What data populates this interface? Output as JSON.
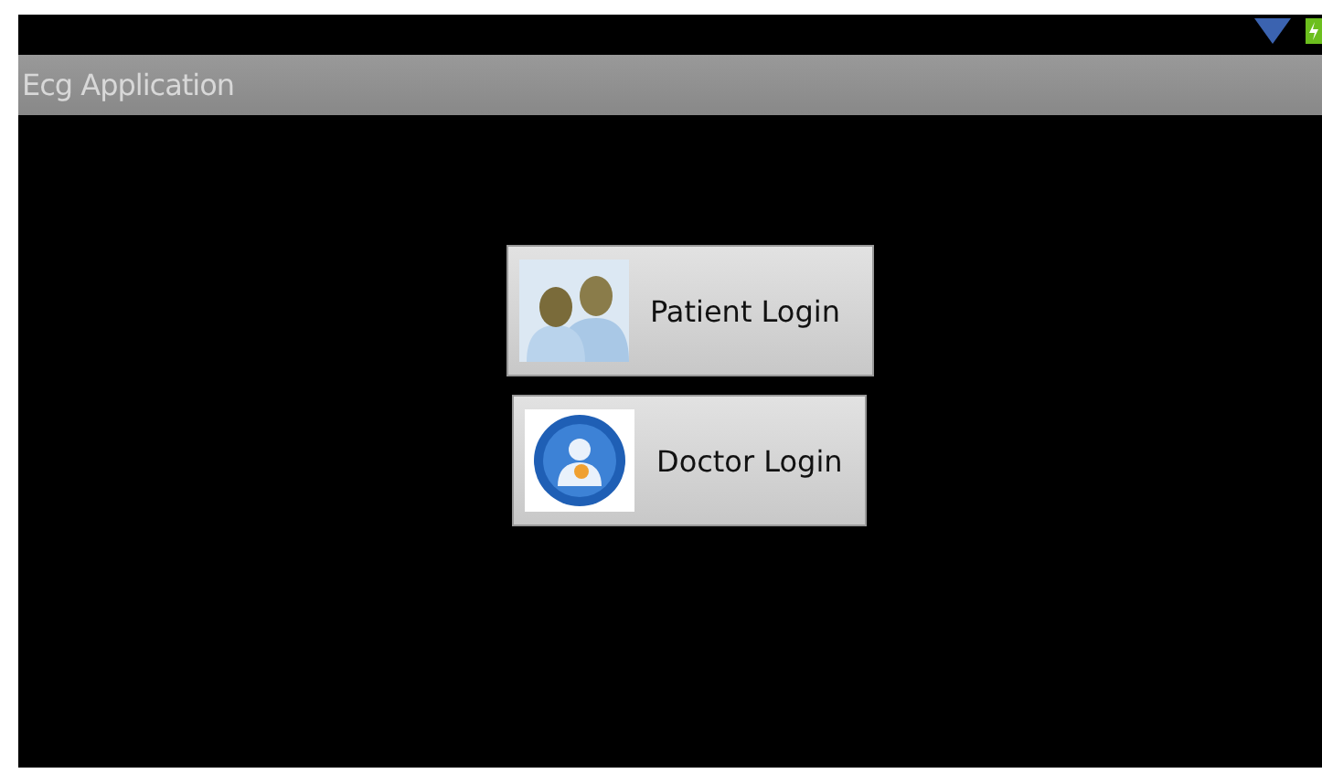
{
  "window": {
    "title": "Ecg Application"
  },
  "buttons": [
    {
      "label": "Patient Login",
      "kind": "patients"
    },
    {
      "label": "Doctor Login",
      "kind": "doctor"
    }
  ]
}
